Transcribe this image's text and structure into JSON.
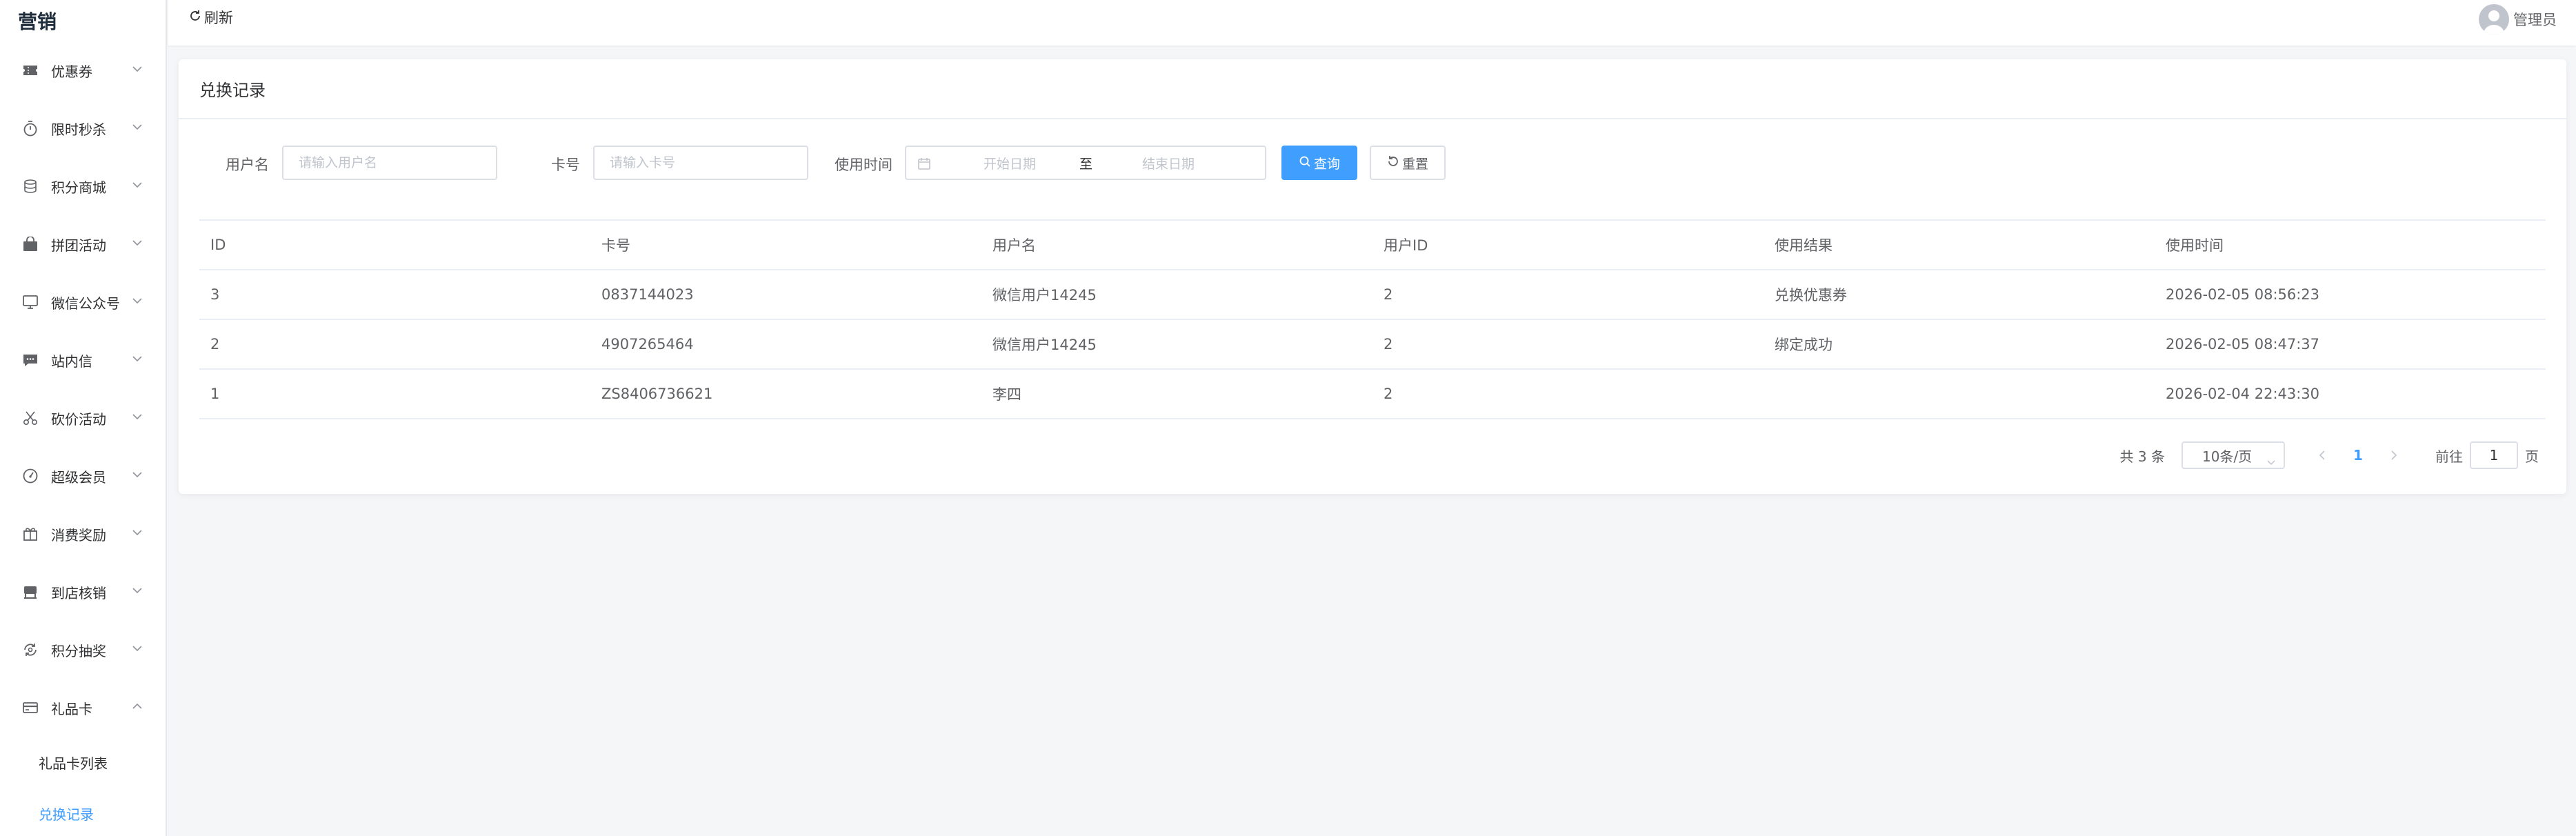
{
  "sidebar": {
    "brand": "营销",
    "items": [
      {
        "label": "优惠券",
        "icon": "ticket-icon"
      },
      {
        "label": "限时秒杀",
        "icon": "stopwatch-icon"
      },
      {
        "label": "积分商城",
        "icon": "coins-icon"
      },
      {
        "label": "拼团活动",
        "icon": "shop-icon"
      },
      {
        "label": "微信公众号",
        "icon": "monitor-icon"
      },
      {
        "label": "站内信",
        "icon": "message-icon"
      },
      {
        "label": "砍价活动",
        "icon": "scissors-icon"
      },
      {
        "label": "超级会员",
        "icon": "gauge-icon"
      },
      {
        "label": "消费奖励",
        "icon": "gift-icon"
      },
      {
        "label": "到店核销",
        "icon": "store-icon"
      },
      {
        "label": "积分抽奖",
        "icon": "lottery-icon"
      },
      {
        "label": "礼品卡",
        "icon": "card-icon"
      }
    ],
    "submenu": [
      "礼品卡列表",
      "兑换记录"
    ]
  },
  "topbar": {
    "refresh_label": "刷新",
    "user_name": "管理员"
  },
  "page": {
    "title": "兑换记录"
  },
  "filters": {
    "username_label": "用户名",
    "username_placeholder": "请输入用户名",
    "card_label": "卡号",
    "card_placeholder": "请输入卡号",
    "time_label": "使用时间",
    "start_placeholder": "开始日期",
    "range_separator": "至",
    "end_placeholder": "结束日期",
    "search_label": "查询",
    "reset_label": "重置"
  },
  "table": {
    "headers": [
      "ID",
      "卡号",
      "用户名",
      "用户ID",
      "使用结果",
      "使用时间"
    ],
    "rows": [
      [
        "3",
        "0837144023",
        "微信用户14245",
        "2",
        "兑换优惠券",
        "2026-02-05 08:56:23"
      ],
      [
        "2",
        "4907265464",
        "微信用户14245",
        "2",
        "绑定成功",
        "2026-02-05 08:47:37"
      ],
      [
        "1",
        "ZS8406736621",
        "李四",
        "2",
        "",
        "2026-02-04 22:43:30"
      ]
    ]
  },
  "pagination": {
    "total": "共 3 条",
    "page_size": "10条/页",
    "current_page": "1",
    "goto_prefix": "前往",
    "goto_value": "1",
    "goto_suffix": "页"
  },
  "colors": {
    "primary": "#409eff",
    "active_menu": "#409eff"
  }
}
